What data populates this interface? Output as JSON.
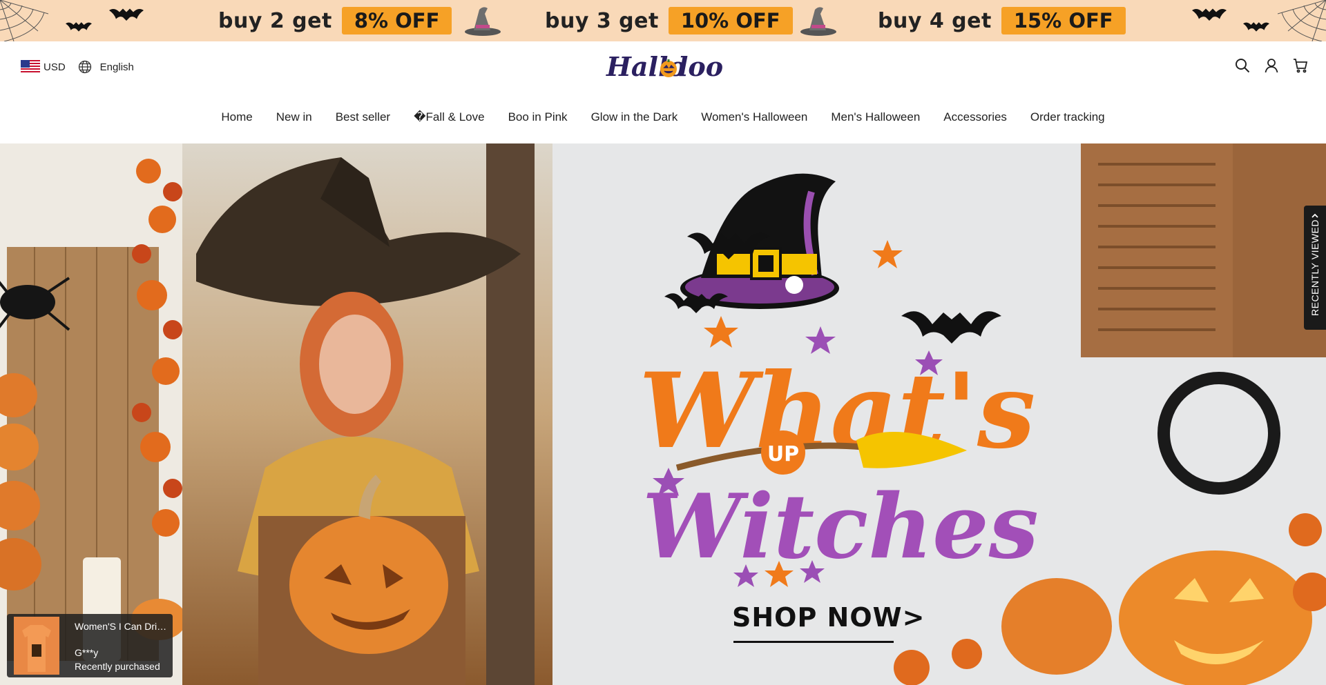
{
  "promo": {
    "offers": [
      {
        "text": "buy 2 get",
        "badge": "8% OFF"
      },
      {
        "text": "buy 3 get",
        "badge": "10% OFF"
      },
      {
        "text": "buy 4 get",
        "badge": "15% OFF"
      }
    ],
    "badge_color": "#f6a126",
    "background": "#f9d9b8"
  },
  "header": {
    "currency": "USD",
    "language": "English",
    "logo_text": "Hallolook",
    "icons": [
      "search-icon",
      "account-icon",
      "cart-icon"
    ]
  },
  "nav": {
    "items": [
      "Home",
      "New in",
      "Best seller",
      "�Fall & Love",
      "Boo in Pink",
      "Glow in the Dark",
      "Women's Halloween",
      "Men's Halloween",
      "Accessories",
      "Order tracking"
    ]
  },
  "hero": {
    "headline_top": "What's",
    "headline_mid": "UP",
    "headline_bottom": "Witches",
    "cta": "SHOP NOW>"
  },
  "recently_viewed": {
    "label": "RECENTLY VIEWED"
  },
  "purchase_popup": {
    "product_name": "Women'S I Can Driv...",
    "buyer": "G***y",
    "status": "Recently purchased"
  }
}
